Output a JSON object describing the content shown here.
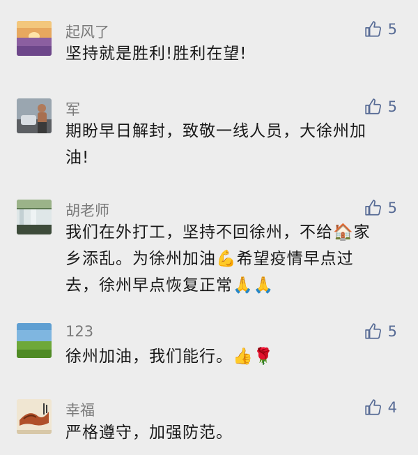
{
  "comments": [
    {
      "name": "起风了",
      "likes": "5",
      "lines": [
        "坚持就是胜利!胜利在望!"
      ]
    },
    {
      "name": "军",
      "likes": "5",
      "lines": [
        "期盼早日解封，致敬一线人员，大徐州加",
        "油!"
      ]
    },
    {
      "name": "胡老师",
      "likes": "5",
      "lines": [
        "我们在外打工，坚持不回徐州，不给🏠家",
        "乡添乱。为徐州加油💪希望疫情早点过",
        "去，徐州早点恢复正常🙏🙏"
      ]
    },
    {
      "name": "123",
      "likes": "5",
      "lines": [
        "徐州加油，我们能行。👍🌹"
      ]
    },
    {
      "name": "幸福",
      "likes": "4",
      "lines": [
        "严格遵守，加强防范。"
      ]
    }
  ],
  "icons": {
    "like": "thumbs-up-icon"
  },
  "colors": {
    "like_color": "#576b95",
    "name_color": "#7a7a7a",
    "text_color": "#191919",
    "background": "#ededed"
  }
}
